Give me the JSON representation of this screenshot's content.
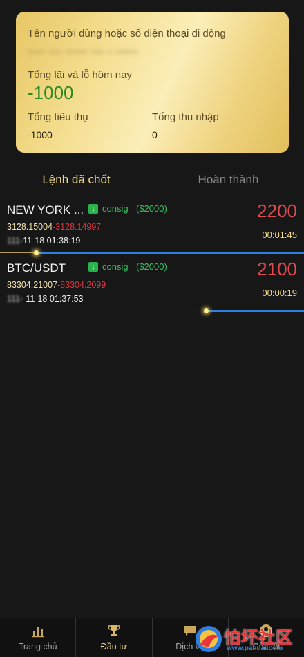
{
  "account_card": {
    "username_label": "Tên người dùng hoặc số điện thoại di động",
    "username_value": "**** *** ***** *** * *****",
    "pnl_label": "Tổng lãi và lỗ hôm nay",
    "pnl_value": "-1000",
    "consume_label": "Tổng tiêu thụ",
    "consume_value": "-1000",
    "income_label": "Tổng thu nhập",
    "income_value": "0"
  },
  "tabs": [
    {
      "label": "Lệnh đã chốt",
      "active": true
    },
    {
      "label": "Hoàn thành",
      "active": false
    }
  ],
  "orders": [
    {
      "symbol": "NEW YORK ...",
      "direction": "consig",
      "direction_icon": "arrow-down-icon",
      "stake": "($2000)",
      "open_price": "3128.15004",
      "separator": "-",
      "close_price": "3128.14997",
      "time_masked": "111-",
      "time": "11-18 01:38:19",
      "amount": "2200",
      "countdown": "00:01:45",
      "progress": 0.88
    },
    {
      "symbol": "BTC/USDT",
      "direction": "consig",
      "direction_icon": "arrow-down-icon",
      "stake": "($2000)",
      "open_price": "83304.21007",
      "separator": "-",
      "close_price": "83304.2099",
      "time_masked": "111-",
      "time": "-11-18 01:37:53",
      "amount": "2100",
      "countdown": "00:00:19",
      "progress": 0.32
    }
  ],
  "bottom_nav": [
    {
      "label": "Trang chủ",
      "icon": "bar-chart-icon",
      "active": false
    },
    {
      "label": "Đầu tư",
      "icon": "trophy-icon",
      "active": true
    },
    {
      "label": "Dịch vụ",
      "icon": "chat-icon",
      "active": false
    },
    {
      "label": "Của tôi",
      "icon": "user-icon",
      "active": false
    }
  ],
  "watermark": {
    "title": "怕坏社区",
    "url": "www.pahuai.com"
  },
  "colors": {
    "card_gold": "#f3dc8c",
    "profit_green": "#2d8a22",
    "loss_red": "#e34a50",
    "accent_gold": "#f1d98a",
    "progress_blue": "#2f7fe0",
    "direction_green": "#38c060"
  }
}
